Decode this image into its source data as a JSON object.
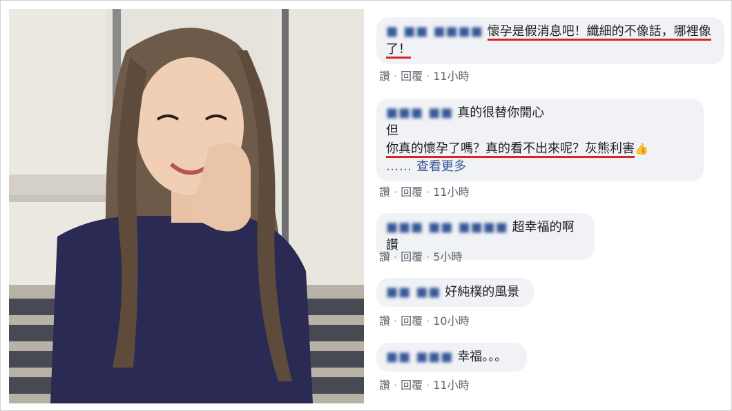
{
  "comments": [
    {
      "author": "■ ■■ ■■■■",
      "text_line1": "懷孕是假消息吧！纖細的不像話，哪裡像",
      "text_line2": "了！",
      "actions": {
        "like": "讚",
        "reply": "回覆",
        "time": "11小時"
      }
    },
    {
      "author": "■■■ ■■",
      "text_line1": "真的很替你開心",
      "text_line2": "但",
      "text_line3": "你真的懷孕了嗎？真的看不出來呢？灰熊利害",
      "thumb_icon": "👍",
      "ellipsis": "……",
      "see_more": "查看更多",
      "actions": {
        "like": "讚",
        "reply": "回覆",
        "time": "11小時"
      }
    },
    {
      "author": "■■■ ■■ ■■■■",
      "text_line1": "超幸福的啊 讚",
      "actions": {
        "like": "讚",
        "reply": "回覆",
        "time": "5小時"
      }
    },
    {
      "author": "■■ ■■",
      "text_line1": "好純樸的風景",
      "actions": {
        "like": "讚",
        "reply": "回覆",
        "time": "10小時"
      }
    },
    {
      "author": "■■ ■■■",
      "text_line1": "幸福。。。",
      "actions": {
        "like": "讚",
        "reply": "回覆",
        "time": "11小時"
      }
    }
  ],
  "colors": {
    "bubble": "#f0f2f5",
    "link": "#385898",
    "meta": "#606770",
    "highlight": "#d8232a"
  }
}
